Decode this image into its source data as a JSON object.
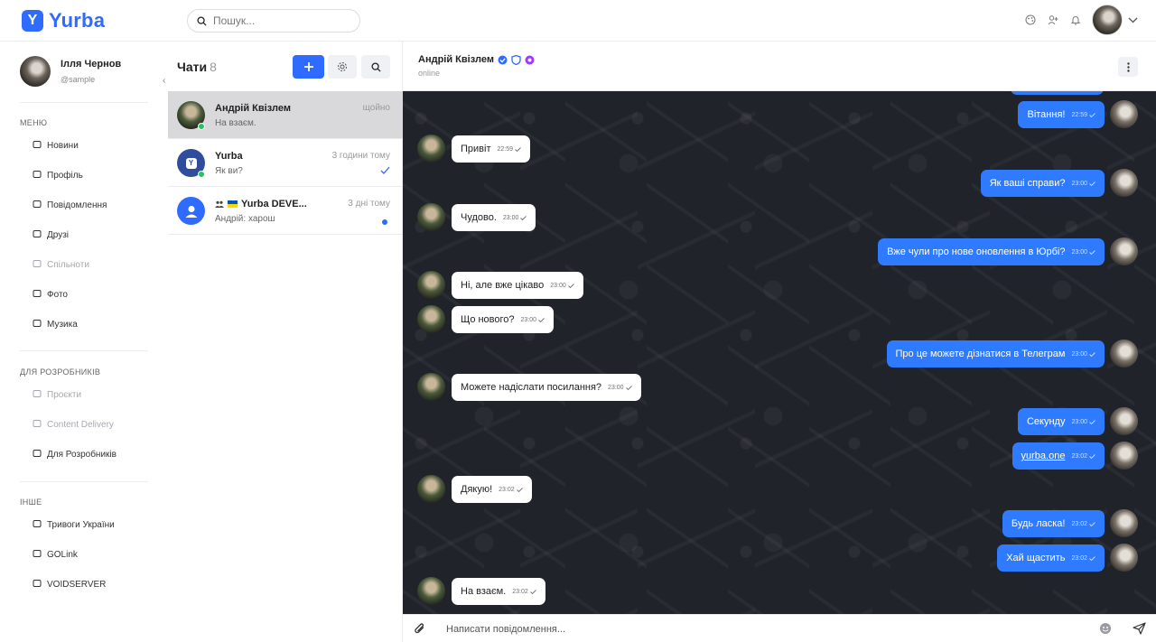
{
  "app": {
    "logo_letter": "Y",
    "logo_text": "Yurba",
    "accent": "#2f6bff"
  },
  "search": {
    "placeholder": "Пошук..."
  },
  "user": {
    "name": "Ілля Чернов",
    "handle": "@sample"
  },
  "sidebar": {
    "menu_title": "МЕНЮ",
    "menu": [
      {
        "label": "Новини",
        "icon": "news-icon",
        "disabled": false
      },
      {
        "label": "Профіль",
        "icon": "user-icon",
        "disabled": false
      },
      {
        "label": "Повідомлення",
        "icon": "message-icon",
        "disabled": false
      },
      {
        "label": "Друзі",
        "icon": "friends-icon",
        "disabled": false
      },
      {
        "label": "Спільноти",
        "icon": "communities-icon",
        "disabled": true
      },
      {
        "label": "Фото",
        "icon": "photo-icon",
        "disabled": false
      },
      {
        "label": "Музика",
        "icon": "headphones-icon",
        "disabled": false
      }
    ],
    "dev_title": "ДЛЯ РОЗРОБНИКІВ",
    "dev": [
      {
        "label": "Проєкти",
        "icon": "projects-icon",
        "disabled": true
      },
      {
        "label": "Content Delivery",
        "icon": "cdn-icon",
        "disabled": true
      },
      {
        "label": "Для Розробників",
        "icon": "code-icon",
        "disabled": false
      }
    ],
    "other_title": "ІНШЕ",
    "other": [
      {
        "label": "Тривоги України",
        "icon": "alert-icon",
        "disabled": false
      },
      {
        "label": "GOLink",
        "icon": "golink-icon",
        "disabled": false
      },
      {
        "label": "VOIDSERVER",
        "icon": "voidserver-icon",
        "disabled": false
      }
    ]
  },
  "chats": {
    "title": "Чати",
    "count": "8",
    "items": [
      {
        "name": "Андрій Квізлем",
        "time": "щойно",
        "preview": "На взаєм.",
        "online": true,
        "active": true
      },
      {
        "name": "Yurba",
        "time": "3 години тому",
        "preview": "Як ви?",
        "online": true,
        "active": false,
        "read": true
      },
      {
        "name": "Yurba DEVE...",
        "time": "3 дні тому",
        "preview": "Андрій: харош",
        "online": false,
        "active": false,
        "unread": true
      }
    ]
  },
  "conversation": {
    "name": "Андрій Квізлем",
    "status": "online",
    "messages": [
      {
        "dir": "out",
        "text": "Вітання!",
        "time": "22:59"
      },
      {
        "dir": "in",
        "text": "Привіт",
        "time": "22:59"
      },
      {
        "dir": "out",
        "text": "Як ваші справи?",
        "time": "23:00"
      },
      {
        "dir": "in",
        "text": "Чудово.",
        "time": "23:00"
      },
      {
        "dir": "out",
        "text": "Вже чули про нове оновлення в Юрбі?",
        "time": "23:00"
      },
      {
        "dir": "in",
        "text": "Ні, але вже цікаво",
        "time": "23:00"
      },
      {
        "dir": "in",
        "text": "Що нового?",
        "time": "23:00"
      },
      {
        "dir": "out",
        "text": "Про це можете дізнатися в Телеграм",
        "time": "23:00"
      },
      {
        "dir": "in",
        "text": "Можете надіслати посилання?",
        "time": "23:00"
      },
      {
        "dir": "out",
        "text": "Секунду",
        "time": "23:00"
      },
      {
        "dir": "out",
        "text": "yurba.one",
        "time": "23:02",
        "link": true
      },
      {
        "dir": "in",
        "text": "Дякую!",
        "time": "23:02"
      },
      {
        "dir": "out",
        "text": "Будь ласка!",
        "time": "23:02"
      },
      {
        "dir": "out",
        "text": "Хай щастить",
        "time": "23:02"
      },
      {
        "dir": "in",
        "text": "На взаєм.",
        "time": "23:02"
      }
    ]
  },
  "composer": {
    "placeholder": "Написати повідомлення..."
  }
}
